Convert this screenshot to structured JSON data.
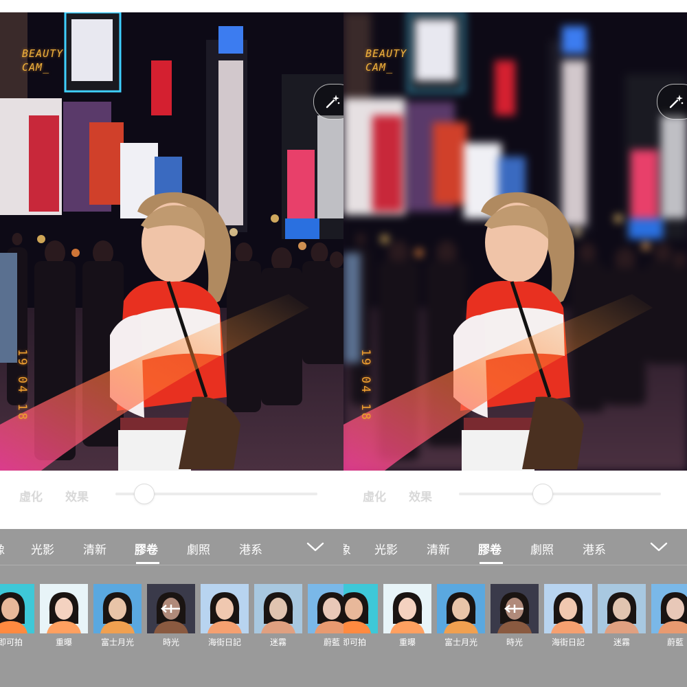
{
  "panels": [
    {
      "id": "left",
      "blurred": false,
      "watermark_line1": "BEAUTY",
      "watermark_line2": "CAM_",
      "date_stamp": "19 04 18",
      "effect_controls": {
        "blur_label": "虛化",
        "effect_label": "效果",
        "slider_level": 0.14
      },
      "categories": {
        "partial_left": "像",
        "items": [
          "光影",
          "清新",
          "膠卷",
          "劇照",
          "港系"
        ],
        "active": "膠卷"
      },
      "filters": [
        {
          "label": "即可拍",
          "palette": "cyan"
        },
        {
          "label": "重曝",
          "palette": "soft"
        },
        {
          "label": "富士月光",
          "palette": "bluewarm"
        },
        {
          "label": "時光",
          "palette": "dark"
        },
        {
          "label": "海街日記",
          "palette": "blue",
          "selected": true
        },
        {
          "label": "迷霧",
          "palette": "mist"
        },
        {
          "label": "蔚藍",
          "palette": "azure"
        }
      ]
    },
    {
      "id": "right",
      "blurred": true,
      "watermark_line1": "BEAUTY",
      "watermark_line2": "CAM_",
      "date_stamp": "19 04 18",
      "effect_controls": {
        "blur_label": "虛化",
        "effect_label": "效果",
        "slider_level": 0.41
      },
      "categories": {
        "partial_left": "象",
        "items": [
          "光影",
          "清新",
          "膠卷",
          "劇照",
          "港系"
        ],
        "active": "膠卷"
      },
      "filters": [
        {
          "label": "即可拍",
          "palette": "cyan"
        },
        {
          "label": "重曝",
          "palette": "soft"
        },
        {
          "label": "富士月光",
          "palette": "bluewarm"
        },
        {
          "label": "時光",
          "palette": "dark"
        },
        {
          "label": "海街日記",
          "palette": "blue",
          "selected": true
        },
        {
          "label": "迷霧",
          "palette": "mist"
        },
        {
          "label": "蔚藍",
          "palette": "azure"
        }
      ]
    }
  ],
  "icons": {
    "magic": "magic-wand-icon",
    "expand": "chevron-down-icon",
    "compare": "compare-slider-icon"
  },
  "colors": {
    "accent_watermark": "#f0b23c",
    "gray_bg": "#9a9a9a",
    "label_gray": "#d8d8d8"
  }
}
